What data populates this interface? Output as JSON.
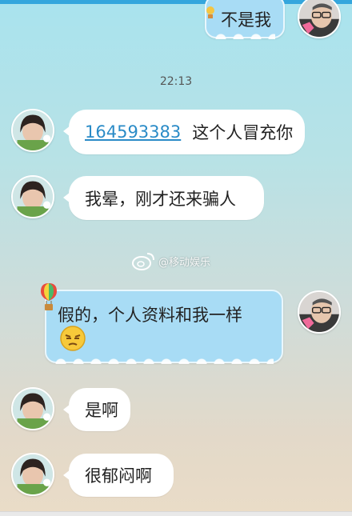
{
  "messages": [
    {
      "side": "right",
      "text": "不是我"
    },
    {
      "side": "left",
      "link": "164593383",
      "text": "这个人冒充你"
    },
    {
      "side": "left",
      "text": "我晕，刚才还来骗人"
    },
    {
      "side": "right",
      "text": "假的，个人资料和我一样"
    },
    {
      "side": "left",
      "text": "是啊"
    },
    {
      "side": "left",
      "text": "很郁闷啊"
    }
  ],
  "timestamp": "22:13",
  "watermark": "@移动娱乐"
}
